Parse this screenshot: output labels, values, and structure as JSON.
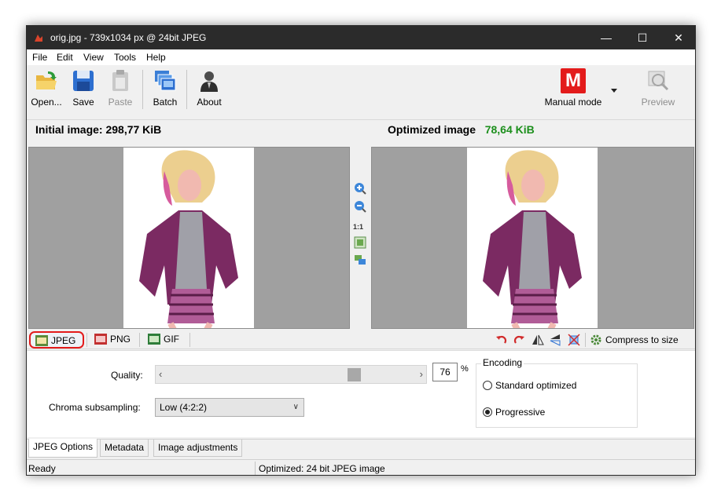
{
  "window": {
    "title": "orig.jpg - 739x1034 px @ 24bit JPEG",
    "controls": {
      "minimize": "—",
      "maximize": "☐",
      "close": "✕"
    }
  },
  "menu": [
    "File",
    "Edit",
    "View",
    "Tools",
    "Help"
  ],
  "toolbar": {
    "open_label": "Open...",
    "save_label": "Save",
    "paste_label": "Paste",
    "batch_label": "Batch",
    "about_label": "About",
    "mode_letter": "M",
    "mode_label": "Manual mode",
    "preview_label": "Preview"
  },
  "header": {
    "initial_label": "Initial image:",
    "initial_size": "298,77 KiB",
    "optimized_label": "Optimized image",
    "optimized_size": "78,64 KiB"
  },
  "zoom": {
    "one_to_one": "1:1"
  },
  "formats": {
    "jpeg": "JPEG",
    "png": "PNG",
    "gif": "GIF",
    "compress_label": "Compress to size"
  },
  "options": {
    "quality_label": "Quality:",
    "quality_value": "76",
    "quality_fraction": 0.76,
    "percent": "%",
    "chroma_label": "Chroma subsampling:",
    "chroma_value": "Low (4:2:2)",
    "encoding_title": "Encoding",
    "standard_label": "Standard optimized",
    "progressive_label": "Progressive",
    "selected_encoding": "progressive"
  },
  "bottom_tabs": [
    "JPEG Options",
    "Metadata",
    "Image adjustments"
  ],
  "status": {
    "left": "Ready",
    "right": "Optimized: 24 bit JPEG image"
  },
  "colors": {
    "titlebar": "#2b2b2b",
    "accent_red": "#e31b1b",
    "size_green": "#1c8f1c",
    "pane_gray": "#a0a0a0"
  }
}
